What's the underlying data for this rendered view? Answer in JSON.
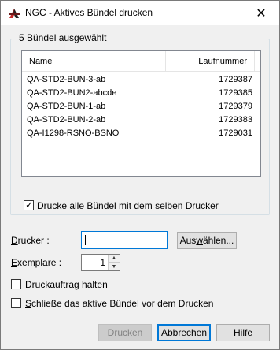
{
  "window": {
    "title": "NGC - Aktives Bündel drucken",
    "close_glyph": "✕"
  },
  "group": {
    "label": "5 Bündel ausgewählt"
  },
  "list": {
    "columns": {
      "name": "Name",
      "number": "Laufnummer"
    },
    "rows": [
      {
        "name": "QA-STD2-BUN-3-ab",
        "number": "1729387"
      },
      {
        "name": "QA-STD2-BUN2-abcde",
        "number": "1729385"
      },
      {
        "name": "QA-STD2-BUN-1-ab",
        "number": "1729379"
      },
      {
        "name": "QA-STD2-BUN-2-ab",
        "number": "1729383"
      },
      {
        "name": "QA-I1298-RSNO-BSNO",
        "number": "1729031"
      }
    ]
  },
  "options": {
    "same_printer": {
      "label": "Drucke alle Bündel mit dem selben Drucker",
      "checked": true
    },
    "hold_job": {
      "label_prefix": "Druckauftrag h",
      "label_accel": "a",
      "label_suffix": "lten",
      "checked": false
    },
    "close_bundle": {
      "label_accel": "S",
      "label_suffix": "chließe das aktive Bündel vor dem Drucken",
      "checked": false
    }
  },
  "printer": {
    "label_accel": "D",
    "label_suffix": "rucker :",
    "value": "",
    "select_button_prefix": "Aus",
    "select_button_accel": "w",
    "select_button_suffix": "ählen..."
  },
  "copies": {
    "label_accel": "E",
    "label_suffix": "xemplare :",
    "value": "1"
  },
  "buttons": {
    "print": "Drucken",
    "cancel": "Abbrechen",
    "help_accel": "H",
    "help_suffix": "ilfe"
  },
  "icons": {
    "app": "ngc-app-icon",
    "checked": "✓",
    "spin_up": "▲",
    "spin_down": "▼"
  },
  "colors": {
    "focus_blue": "#0078d7",
    "dialog_bg": "#f0f0f0"
  }
}
